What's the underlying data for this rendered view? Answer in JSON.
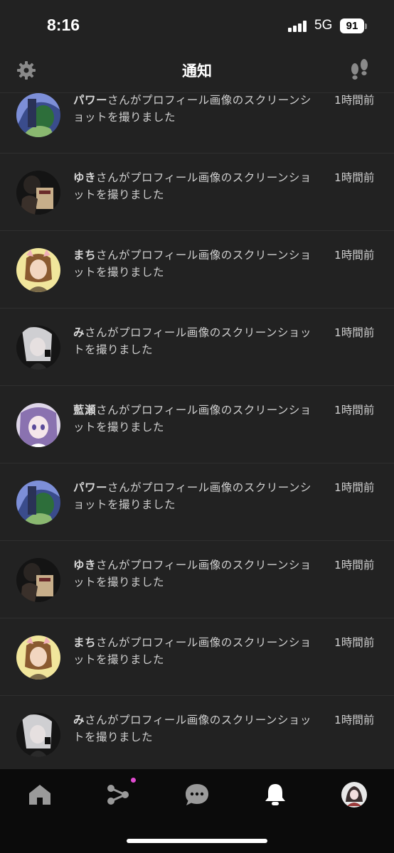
{
  "status": {
    "time": "8:16",
    "network": "5G",
    "battery": "91"
  },
  "header": {
    "title": "通知"
  },
  "notifications": [
    {
      "name": "パワー",
      "text": "さんがプロフィール画像のスクリーンショットを撮りました",
      "time": "1時間前",
      "avatar": "blue-hair"
    },
    {
      "name": "ゆき",
      "text": "さんがプロフィール画像のスクリーンショットを撮りました",
      "time": "1時間前",
      "avatar": "dark-bag"
    },
    {
      "name": "まち",
      "text": "さんがプロフィール画像のスクリーンショットを撮りました",
      "time": "1時間前",
      "avatar": "yellow-girl"
    },
    {
      "name": "み",
      "text": "さんがプロフィール画像のスクリーンショットを撮りました",
      "time": "1時間前",
      "avatar": "silver-hair"
    },
    {
      "name": "藍瀬",
      "text": "さんがプロフィール画像のスクリーンショットを撮りました",
      "time": "1時間前",
      "avatar": "purple-hair"
    },
    {
      "name": "パワー",
      "text": "さんがプロフィール画像のスクリーンショットを撮りました",
      "time": "1時間前",
      "avatar": "blue-hair"
    },
    {
      "name": "ゆき",
      "text": "さんがプロフィール画像のスクリーンショットを撮りました",
      "time": "1時間前",
      "avatar": "dark-bag"
    },
    {
      "name": "まち",
      "text": "さんがプロフィール画像のスクリーンショットを撮りました",
      "time": "1時間前",
      "avatar": "yellow-girl"
    },
    {
      "name": "み",
      "text": "さんがプロフィール画像のスクリーンショットを撮りました",
      "time": "1時間前",
      "avatar": "silver-hair"
    }
  ],
  "tabs": [
    {
      "name": "home",
      "icon": "home-icon"
    },
    {
      "name": "discover",
      "icon": "share-network-icon",
      "badge": true
    },
    {
      "name": "chat",
      "icon": "chat-bubble-icon"
    },
    {
      "name": "notifications",
      "icon": "bell-icon",
      "active": true
    },
    {
      "name": "profile",
      "icon": "profile-avatar"
    }
  ],
  "colors": {
    "background": "#222222",
    "tabbar": "#0b0b0b",
    "badge": "#e04bd0",
    "text": "#cfcfcf"
  }
}
